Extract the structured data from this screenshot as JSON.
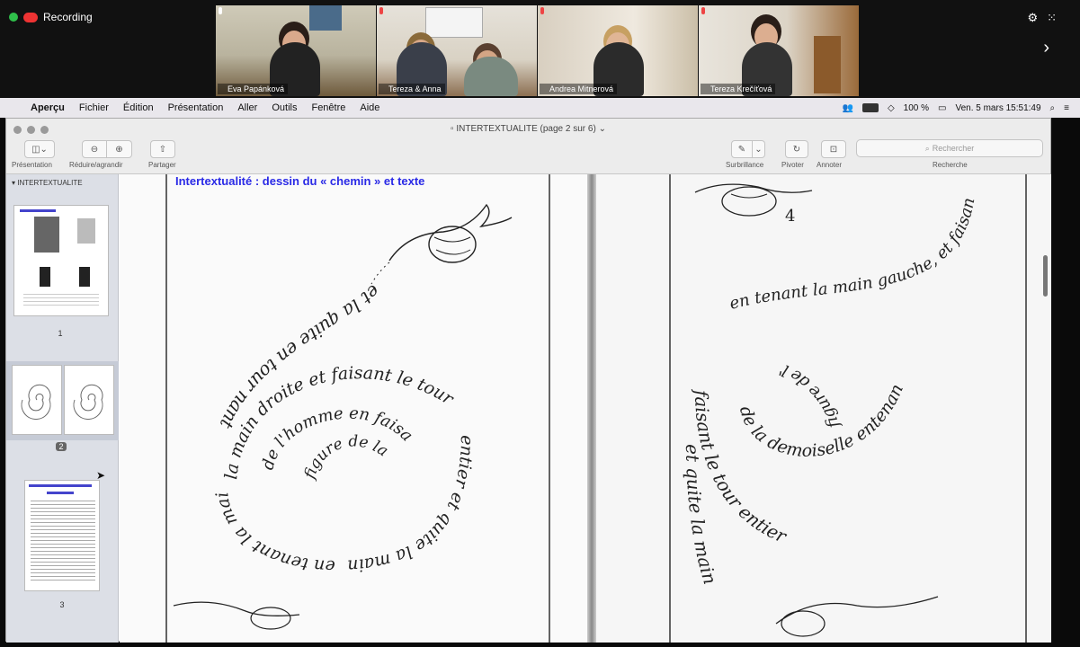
{
  "zoom": {
    "recording_label": "Recording",
    "participants": [
      {
        "name": "Eva Papánková",
        "muted": false
      },
      {
        "name": "Tereza & Anna",
        "muted": true
      },
      {
        "name": "Andrea Mitnerová",
        "muted": true
      },
      {
        "name": "Tereza Krečíťová",
        "muted": true
      }
    ],
    "icons": [
      "gear-icon",
      "grid-icon",
      "chevron-right-icon"
    ]
  },
  "menubar": {
    "app": "Aperçu",
    "items": [
      "Fichier",
      "Édition",
      "Présentation",
      "Aller",
      "Outils",
      "Fenêtre",
      "Aide"
    ],
    "battery": "100 %",
    "datetime": "Ven. 5 mars  15:51:49"
  },
  "window": {
    "title": "INTERTEXTUALITE (page 2 sur 6)",
    "toolbar": {
      "presentation_label": "Présentation",
      "zoom_label": "Réduire/agrandir",
      "share_label": "Partager",
      "highlight_label": "Surbrillance",
      "rotate_label": "Pivoter",
      "annotate_label": "Annoter",
      "search_label": "Recherche",
      "search_placeholder": "Rechercher"
    }
  },
  "sidebar": {
    "heading": "INTERTEXTUALITE",
    "pages": [
      {
        "number": "1"
      },
      {
        "number": "2",
        "selected": true
      },
      {
        "number": "3"
      }
    ]
  },
  "document": {
    "heading": "Intertextualité : dessin du « chemin » et texte",
    "left_spiral": [
      "et la quite en tour nant",
      "la main droite et faisant le tour",
      "de l'homme en faisant",
      "figure de la demoiselle",
      "entier et quite la main",
      "en tenant la main"
    ],
    "right_page_number": "4",
    "right_spiral": [
      "figure de l'homme",
      "de la demoiselle entenant la main gauche et",
      "faisant le tour entier",
      "et quite la main",
      "en tenant la main gauche, et faisant le tour entier"
    ]
  }
}
